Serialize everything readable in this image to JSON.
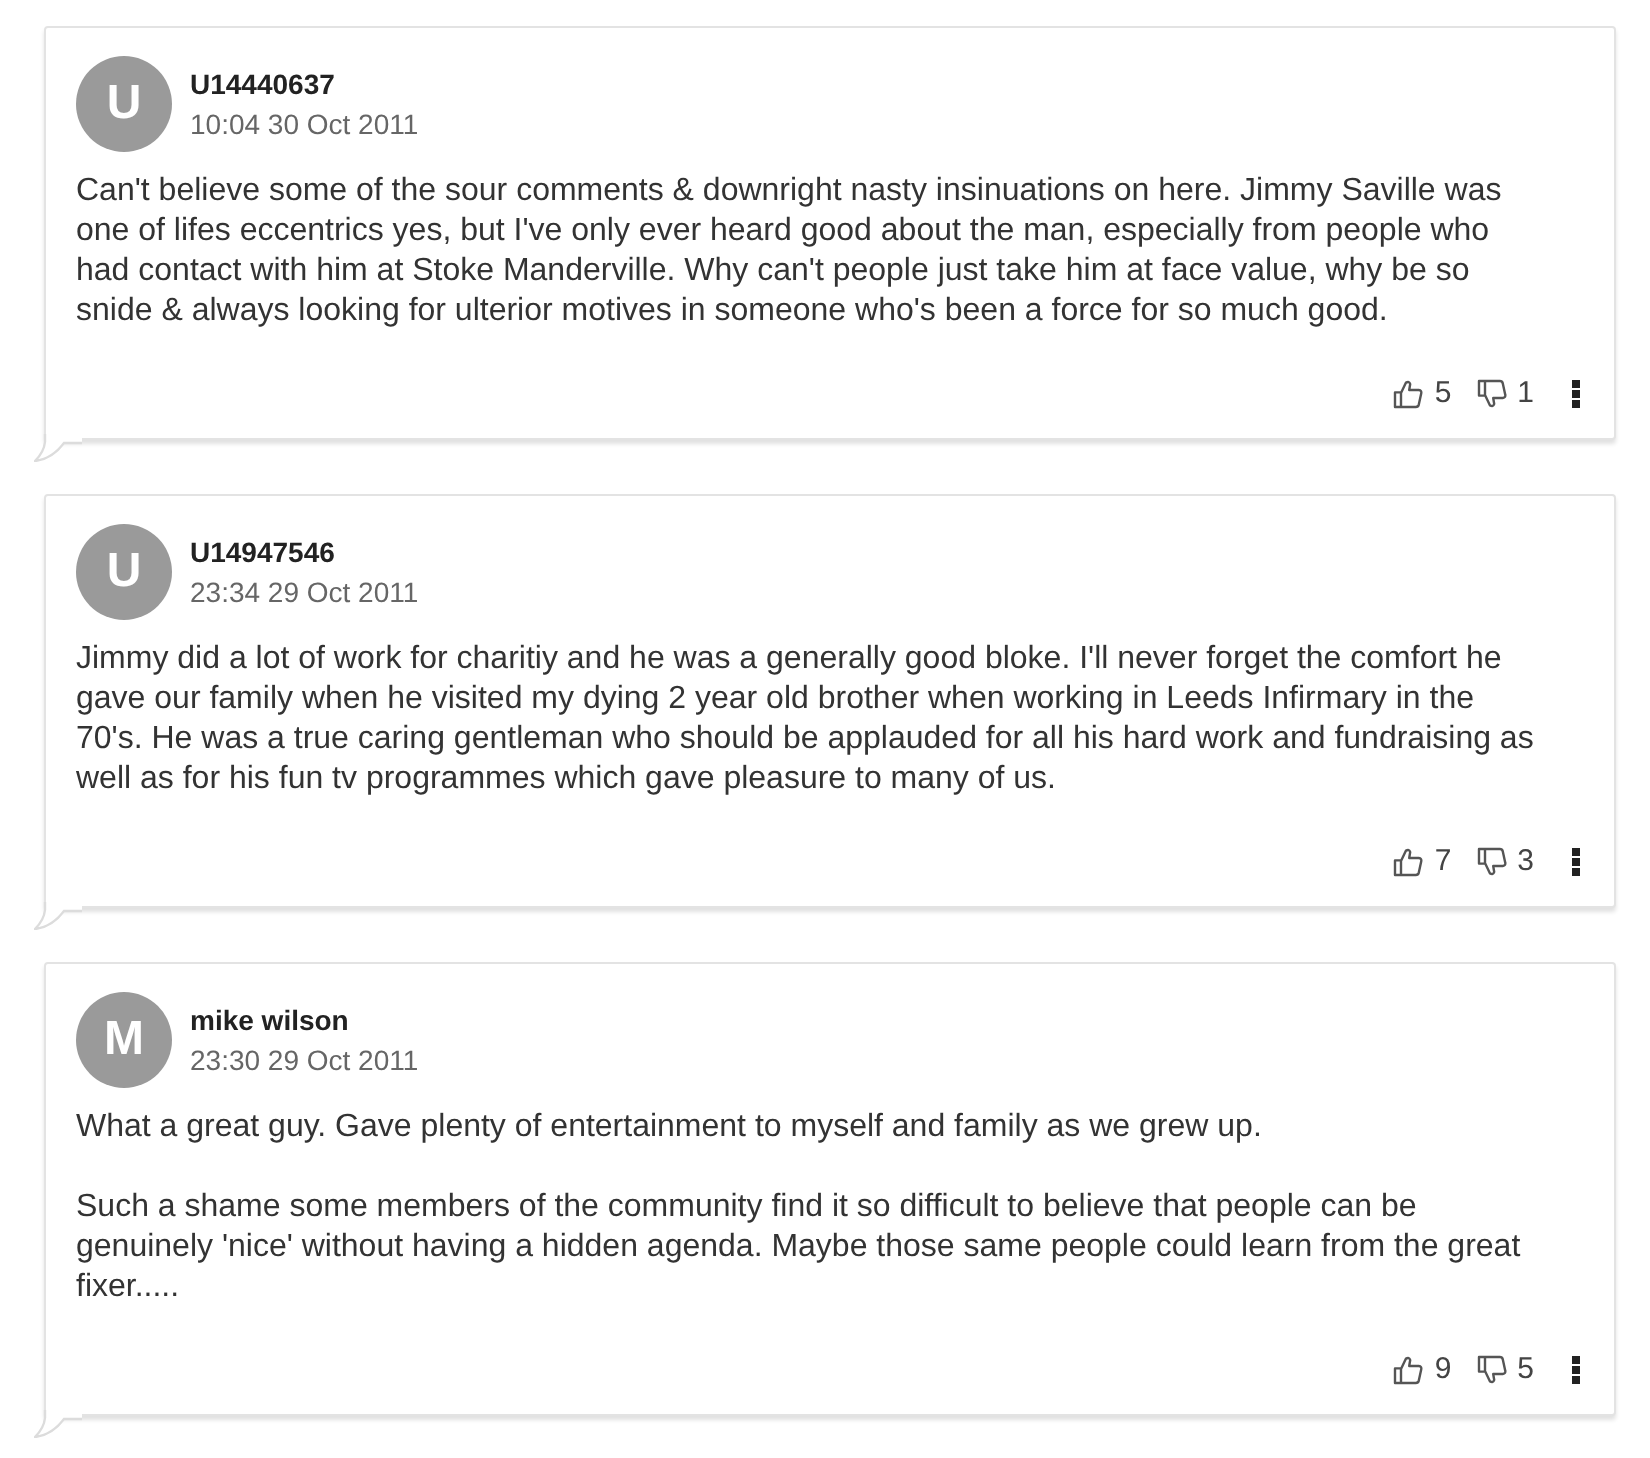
{
  "comments": [
    {
      "avatar_letter": "U",
      "username": "U14440637",
      "timestamp": "10:04 30 Oct 2011",
      "body": [
        "Can't believe some of the sour comments & downright nasty insinuations on here. Jimmy Saville was one of lifes eccentrics yes, but I've only ever heard good about the man, especially from people who had contact with him at Stoke Manderville. Why can't people just take him at face value, why be so snide & always looking for ulterior motives in someone who's been a force for so much good."
      ],
      "likes": "5",
      "dislikes": "1"
    },
    {
      "avatar_letter": "U",
      "username": "U14947546",
      "timestamp": "23:34 29 Oct 2011",
      "body": [
        "Jimmy did a lot of work for charitiy and he was a generally good bloke. I'll never forget the comfort he gave our family when he visited my dying 2 year old brother when working in Leeds Infirmary in the 70's. He was a true caring gentleman who should be applauded for all his hard work and fundraising as well as for his fun tv programmes which gave pleasure to many of us."
      ],
      "likes": "7",
      "dislikes": "3"
    },
    {
      "avatar_letter": "M",
      "username": "mike wilson",
      "timestamp": "23:30 29 Oct 2011",
      "body": [
        "What a great guy. Gave plenty of entertainment to myself and family as we grew up.",
        "Such a shame some members of the community find it so difficult to believe that people can be genuinely 'nice' without having a hidden agenda. Maybe those same people could learn from the great fixer....."
      ],
      "likes": "9",
      "dislikes": "5"
    }
  ]
}
